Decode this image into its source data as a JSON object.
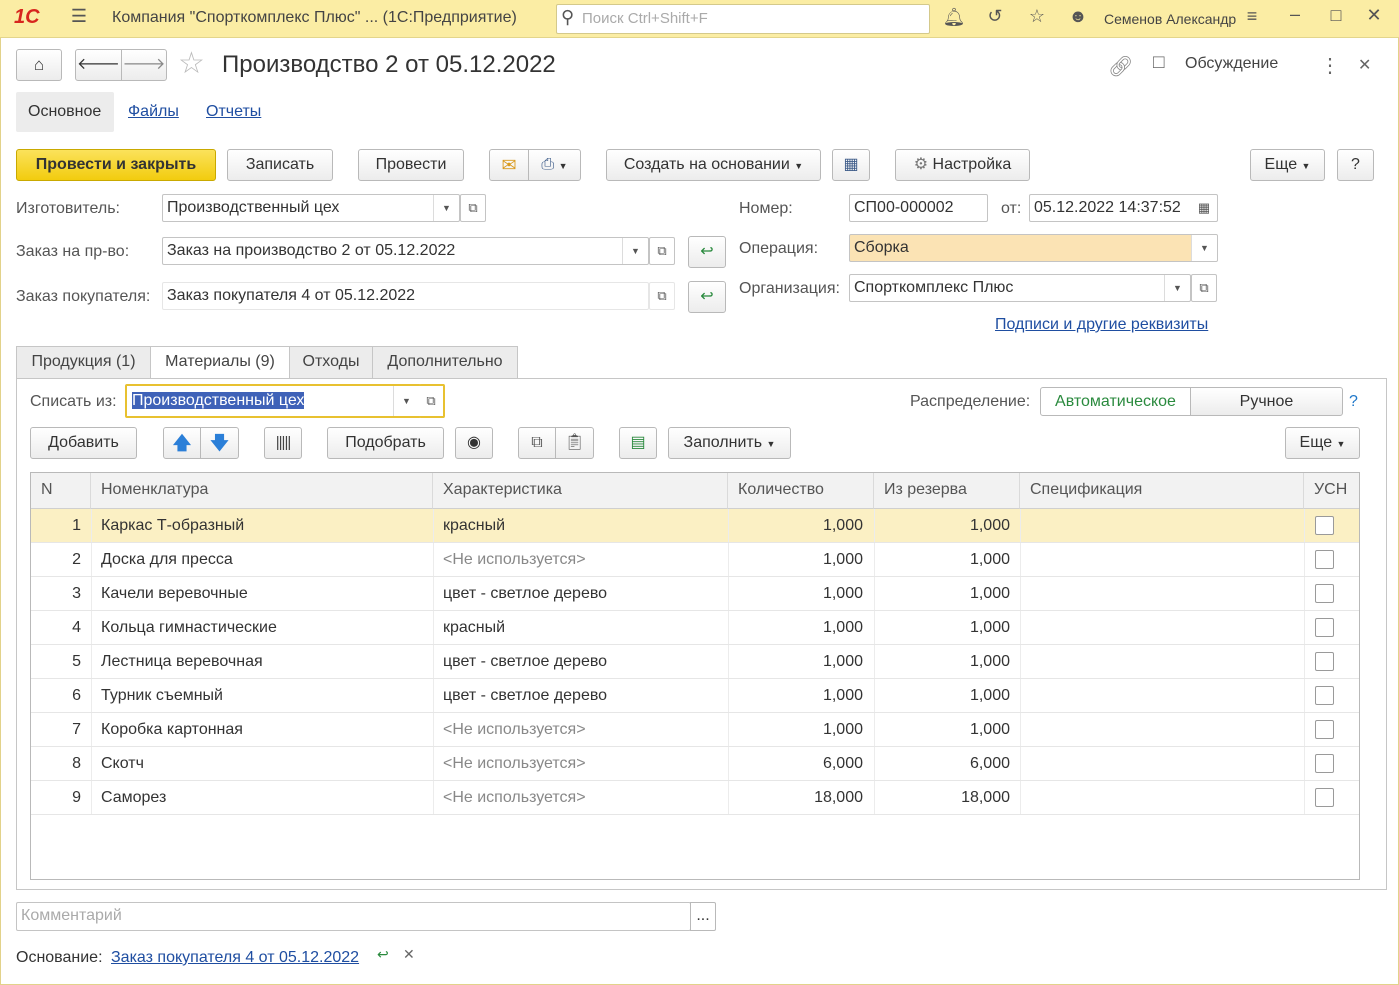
{
  "titlebar": {
    "app_logo": "1С",
    "window_title": "Компания \"Спорткомплекс Плюс\" ... (1С:Предприятие)",
    "search_placeholder": "Поиск Ctrl+Shift+F",
    "user": "Семенов Александр"
  },
  "header": {
    "doc_title": "Производство 2 от 05.12.2022",
    "discussion_label": "Обсуждение"
  },
  "sections": [
    "Основное",
    "Файлы",
    "Отчеты"
  ],
  "toolbar": {
    "post_close": "Провести и закрыть",
    "save": "Записать",
    "post": "Провести",
    "create_based": "Создать на основании",
    "settings": "Настройка",
    "more": "Еще",
    "help": "?"
  },
  "form": {
    "maker_label": "Изготовитель:",
    "maker_value": "Производственный цех",
    "order_label": "Заказ на пр-во:",
    "order_value": "Заказ на производство 2 от 05.12.2022",
    "customer_order_label": "Заказ покупателя:",
    "customer_order_value": "Заказ покупателя 4 от 05.12.2022",
    "number_label": "Номер:",
    "number_value": "СП00-000002",
    "date_label": "от:",
    "date_value": "05.12.2022 14:37:52",
    "operation_label": "Операция:",
    "operation_value": "Сборка",
    "org_label": "Организация:",
    "org_value": "Спорткомплекс Плюс",
    "signatures_link": "Подписи и другие реквизиты"
  },
  "tabs": [
    "Продукция (1)",
    "Материалы (9)",
    "Отходы",
    "Дополнительно"
  ],
  "materials": {
    "writeoff_label": "Списать из:",
    "writeoff_value": "Производственный цех",
    "distribution_label": "Распределение:",
    "dist_auto": "Автоматическое",
    "dist_manual": "Ручное",
    "dist_help": "?",
    "add": "Добавить",
    "pick": "Подобрать",
    "fill": "Заполнить",
    "more": "Еще"
  },
  "table": {
    "columns": [
      "N",
      "Номенклатура",
      "Характеристика",
      "Количество",
      "Из резерва",
      "Спецификация",
      "УСН"
    ],
    "rows": [
      {
        "n": "1",
        "name": "Каркас Т-образный",
        "char": "красный",
        "qty": "1,000",
        "reserve": "1,000",
        "spec": ""
      },
      {
        "n": "2",
        "name": "Доска для пресса",
        "char": "<Не используется>",
        "qty": "1,000",
        "reserve": "1,000",
        "spec": ""
      },
      {
        "n": "3",
        "name": "Качели веревочные",
        "char": "цвет - светлое дерево",
        "qty": "1,000",
        "reserve": "1,000",
        "spec": ""
      },
      {
        "n": "4",
        "name": "Кольца гимнастические",
        "char": "красный",
        "qty": "1,000",
        "reserve": "1,000",
        "spec": ""
      },
      {
        "n": "5",
        "name": "Лестница веревочная",
        "char": "цвет - светлое дерево",
        "qty": "1,000",
        "reserve": "1,000",
        "spec": ""
      },
      {
        "n": "6",
        "name": "Турник съемный",
        "char": "цвет - светлое дерево",
        "qty": "1,000",
        "reserve": "1,000",
        "spec": ""
      },
      {
        "n": "7",
        "name": "Коробка картонная",
        "char": "<Не используется>",
        "qty": "1,000",
        "reserve": "1,000",
        "spec": ""
      },
      {
        "n": "8",
        "name": "Скотч",
        "char": "<Не используется>",
        "qty": "6,000",
        "reserve": "6,000",
        "spec": ""
      },
      {
        "n": "9",
        "name": "Саморез",
        "char": "<Не используется>",
        "qty": "18,000",
        "reserve": "18,000",
        "spec": ""
      }
    ]
  },
  "footer": {
    "comment_placeholder": "Комментарий",
    "comment_btn": "...",
    "basis_label": "Основание:",
    "basis_link": "Заказ покупателя 4 от 05.12.2022"
  },
  "colors": {
    "titlebar_bg": "#fbeda4",
    "primary_button": "#f2cc0e",
    "link": "#1f4ea1",
    "selected_row": "#fbf0c4",
    "operation_field": "#fbe3b4",
    "focus_border": "#e8c130",
    "auto_text": "#2a8a3e",
    "arrow_blue": "#2b7fd8"
  }
}
